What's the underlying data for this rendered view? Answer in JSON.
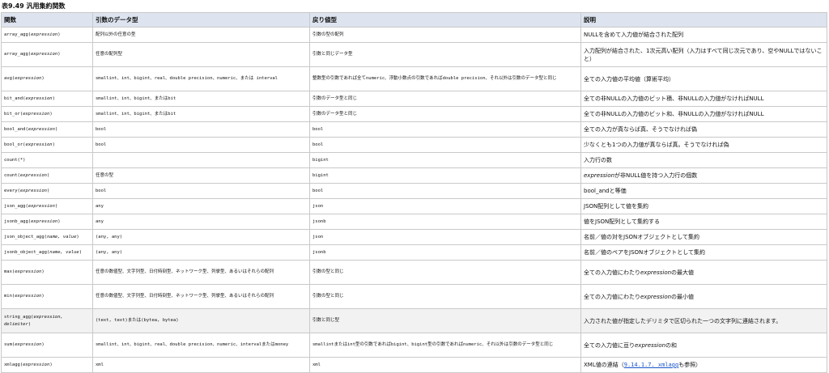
{
  "caption": "表9.49 汎用集約関数",
  "columns": [
    "関数",
    "引数のデータ型",
    "戻り値型",
    "説明"
  ],
  "rows": [
    {
      "fn": "array_agg(",
      "param": "expression",
      "close": ")",
      "args": "配列以外の任意の型",
      "ret": "引数の型の配列",
      "d1": "NULLを含めて入力値が結合された配列",
      "d2": "",
      "d3": ""
    },
    {
      "fn": "array_agg(",
      "param": "expression",
      "close": ")",
      "args": "任意の配列型",
      "ret": "引数と同じデータ型",
      "d1": "入力配列が結合された、1次元高い配列（入力はすべて同じ次元であり、空やNULLではないこと）",
      "d2": "",
      "d3": ""
    },
    {
      "fn": "avg(",
      "param": "expression",
      "close": ")",
      "args": "smallint、int、bigint、real、double precision、numeric、または interval",
      "ret": "整数型の引数であれば全てnumeric、浮動小数点の引数であればdouble precision、それ以外は引数のデータ型と同じ",
      "d1": "全ての入力値の平均値（算術平均）",
      "d2": "",
      "d3": ""
    },
    {
      "fn": "bit_and(",
      "param": "expression",
      "close": ")",
      "args": "smallint、int、bigint、またはbit",
      "ret": "引数のデータ型と同じ",
      "d1": "全ての非NULLの入力値のビット積、非NULLの入力値がなければNULL",
      "d2": "",
      "d3": ""
    },
    {
      "fn": "bit_or(",
      "param": "expression",
      "close": ")",
      "args": "smallint、int、bigint、またはbit",
      "ret": "引数のデータ型と同じ",
      "d1": "全ての非NULLの入力値のビット和、非NULLの入力値がなければNULL",
      "d2": "",
      "d3": ""
    },
    {
      "fn": "bool_and(",
      "param": "expression",
      "close": ")",
      "args": "bool",
      "ret": "bool",
      "d1": "全ての入力が真ならば真、そうでなければ偽",
      "d2": "",
      "d3": ""
    },
    {
      "fn": "bool_or(",
      "param": "expression",
      "close": ")",
      "args": "bool",
      "ret": "bool",
      "d1": "少なくとも1つの入力値が真ならば真。そうでなければ偽",
      "d2": "",
      "d3": ""
    },
    {
      "fn": "count(*)",
      "param": "",
      "close": "",
      "args": "",
      "ret": "bigint",
      "d1": "入力行の数",
      "d2": "",
      "d3": ""
    },
    {
      "fn": "count(",
      "param": "expression",
      "close": ")",
      "args": "任意の型",
      "ret": "bigint",
      "d1": "",
      "d2": "expression",
      "d3": "が非NULL値を持つ入力行の個数"
    },
    {
      "fn": "every(",
      "param": "expression",
      "close": ")",
      "args": "bool",
      "ret": "bool",
      "d1": "bool_andと等価",
      "d2": "",
      "d3": ""
    },
    {
      "fn": "json_agg(",
      "param": "expression",
      "close": ")",
      "args": "any",
      "ret": "json",
      "d1": "JSON配列として値を集約",
      "d2": "",
      "d3": ""
    },
    {
      "fn": "jsonb_agg(",
      "param": "expression",
      "close": ")",
      "args": "any",
      "ret": "jsonb",
      "d1": "値をJSON配列として集約する",
      "d2": "",
      "d3": ""
    },
    {
      "fn": "json_object_agg(",
      "param": "name, value",
      "close": ")",
      "args": "(any, any)",
      "ret": "json",
      "d1": "名前／値の対をJSONオブジェクトとして集約",
      "d2": "",
      "d3": ""
    },
    {
      "fn": "jsonb_object_agg(",
      "param": "name, value",
      "close": ")",
      "args": "(any, any)",
      "ret": "jsonb",
      "d1": "名前／値のペアをJSONオブジェクトとして集約",
      "d2": "",
      "d3": ""
    },
    {
      "fn": "max(",
      "param": "expression",
      "close": ")",
      "args": "任意の数値型、文字列型、日付時刻型、ネットワーク型、列挙型、あるいはそれらの配列",
      "ret": "引数の型と同じ",
      "d1": "全ての入力値にわたり",
      "d2": "expression",
      "d3": "の最大値"
    },
    {
      "fn": "min(",
      "param": "expression",
      "close": ")",
      "args": "任意の数値型、文字列型、日付時刻型、ネットワーク型、列挙型、あるいはそれらの配列",
      "ret": "引数の型と同じ",
      "d1": "全ての入力値にわたり",
      "d2": "expression",
      "d3": "の最小値"
    },
    {
      "fn": "string_agg(",
      "param": "expression, delimiter",
      "close": ")",
      "args": "(text, text)または(bytea, bytea)",
      "ret": "引数と同じ型",
      "d1": "入力された値が指定したデリミタで区切られた一つの文字列に連結されます。",
      "d2": "",
      "d3": ""
    },
    {
      "fn": "sum(",
      "param": "expression",
      "close": ")",
      "args": "smallint、int、bigint、real、double precision、numeric、intervalまたはmoney",
      "ret": "smallintまたはint型の引数であればbigint、bigint型の引数であればnumeric、それ以外は引数のデータ型と同じ",
      "d1": "全ての入力値に亘り",
      "d2": "expression",
      "d3": "の和"
    },
    {
      "fn": "xmlagg(",
      "param": "expression",
      "close": ")",
      "args": "xml",
      "ret": "xml",
      "d1": "XML値の連結（",
      "d2": "9.14.1.7. xmlagg",
      "d3": "も参照）"
    }
  ]
}
